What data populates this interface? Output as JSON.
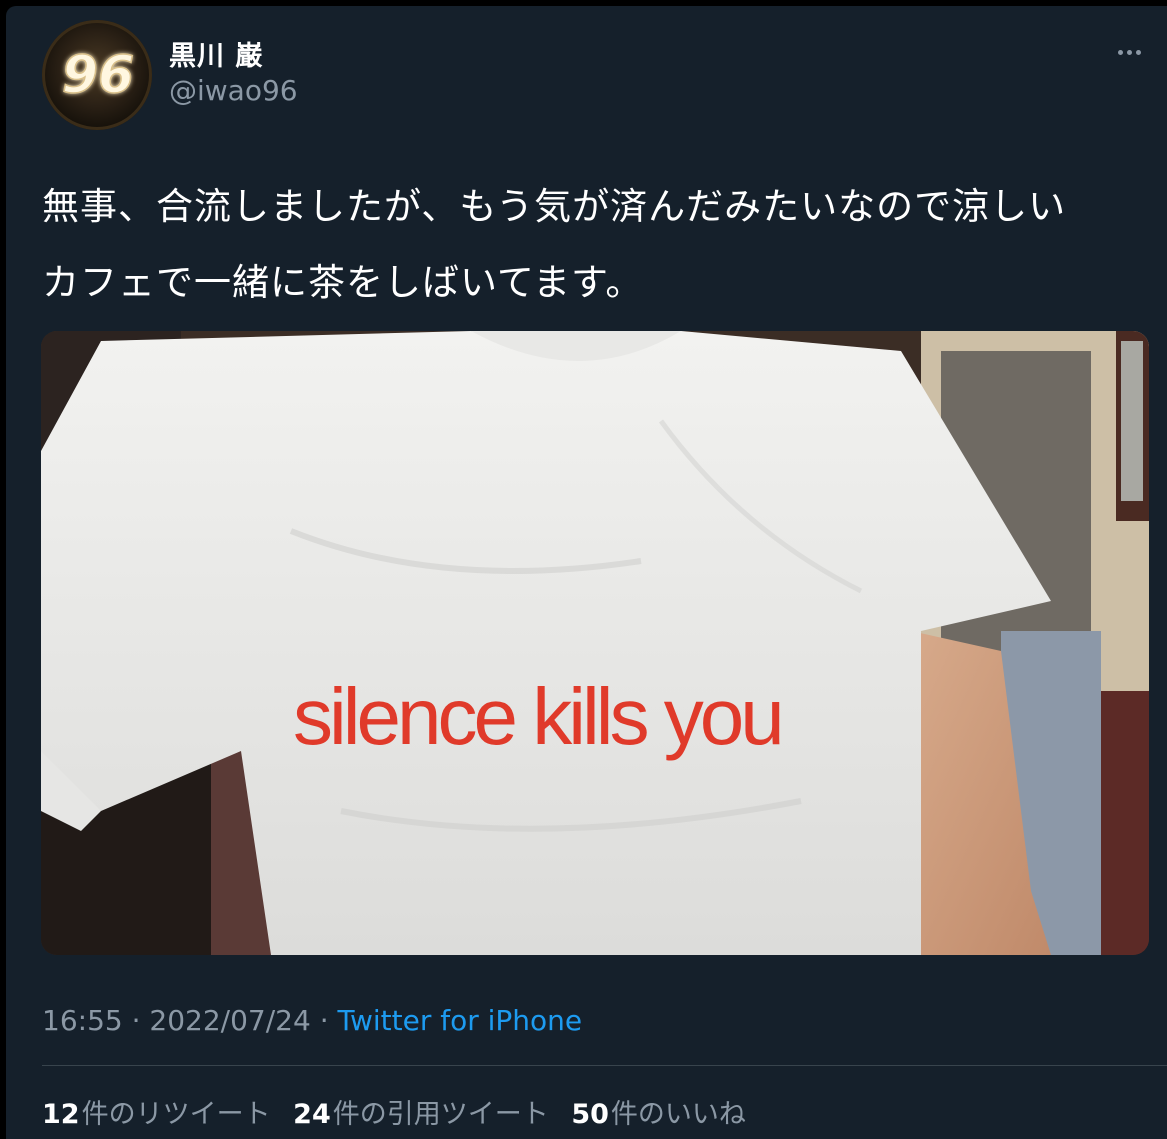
{
  "author": {
    "name": "黒川 巌",
    "handle": "@iwao96",
    "avatar_text": "96"
  },
  "more_icon": "more-horizontal-icon",
  "tweet": {
    "text": "無事、合流しましたが、もう気が済んだみたいなので涼しい\nカフェで一緒に茶をしばいてます。"
  },
  "photo": {
    "shirt_text": "silence kills you",
    "shirt_text_color": "#e03a2a"
  },
  "meta": {
    "time": "16:55",
    "separator": " · ",
    "date": "2022/07/24",
    "separator2": " · ",
    "source": "Twitter for iPhone"
  },
  "stats": {
    "retweets": {
      "count": "12",
      "label": "件のリツイート"
    },
    "quotes": {
      "count": "24",
      "label": "件の引用ツイート"
    },
    "likes": {
      "count": "50",
      "label": "件のいいね"
    }
  },
  "colors": {
    "background": "#15202b",
    "text_primary": "#ffffff",
    "text_secondary": "#8b98a5",
    "link": "#1d9bf0"
  }
}
